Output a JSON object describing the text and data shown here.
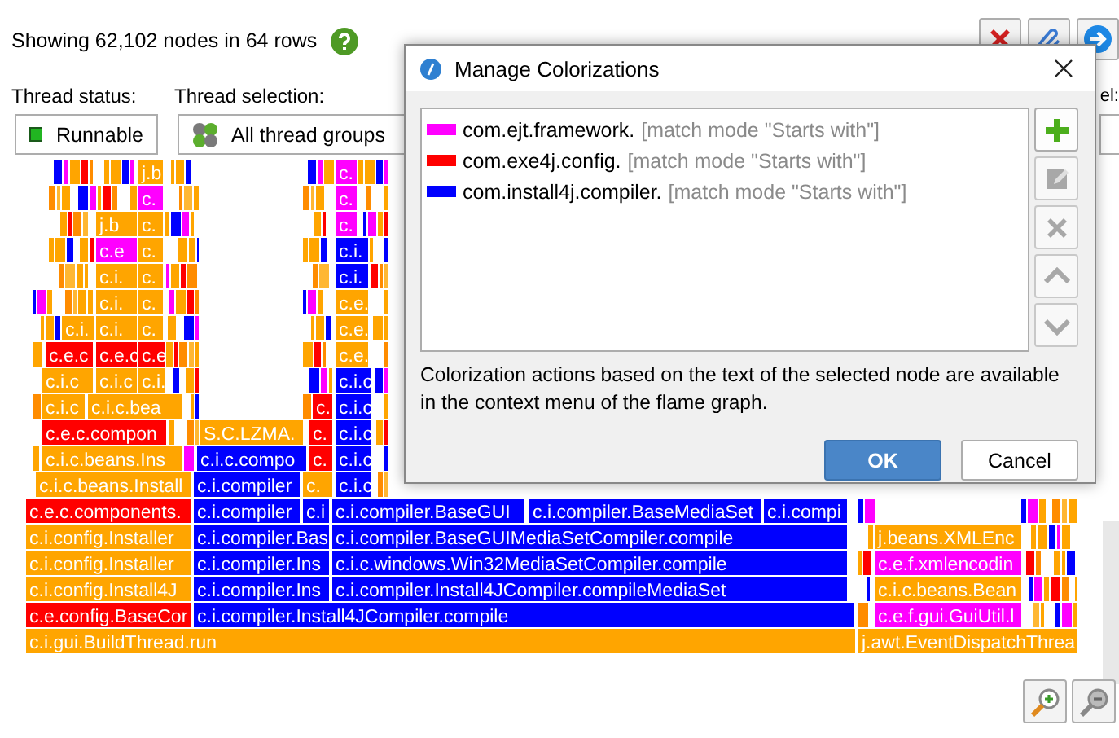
{
  "summary": {
    "text": "Showing 62,102 nodes in 64 rows"
  },
  "filters": [
    {
      "label": "Thread status:",
      "value": "Runnable",
      "kind": "status"
    },
    {
      "label": "Thread selection:",
      "value": "All thread groups",
      "kind": "threads"
    }
  ],
  "level_label": "el:",
  "flame_graph": {
    "rows": [
      [
        {
          "label": "j.b",
          "color": "#ffa500"
        },
        {
          "label": "c.",
          "color": "#ff00ff"
        }
      ],
      [
        {
          "label": "c.",
          "color": "#ff00ff"
        },
        {
          "label": "c.",
          "color": "#ff00ff"
        }
      ],
      [
        {
          "label": "j.b",
          "color": "#ffa500"
        },
        {
          "label": "c.",
          "color": "#ffa500"
        },
        {
          "label": "c.",
          "color": "#ff00ff"
        }
      ],
      [
        {
          "label": "c.e",
          "color": "#ff00ff"
        },
        {
          "label": "c.",
          "color": "#ffa500"
        },
        {
          "label": "c.i.",
          "color": "#0000ff"
        }
      ],
      [
        {
          "label": "c.i.",
          "color": "#ffa500"
        },
        {
          "label": "c.",
          "color": "#ffa500"
        },
        {
          "label": "c.i.",
          "color": "#0000ff"
        }
      ],
      [
        {
          "label": "c.i.",
          "color": "#ffa500"
        },
        {
          "label": "c.",
          "color": "#ffa500"
        },
        {
          "label": "c.e.",
          "color": "#ffa500"
        }
      ],
      [
        {
          "label": "c.i.",
          "color": "#ffa500"
        },
        {
          "label": "c.i.",
          "color": "#ffa500"
        },
        {
          "label": "c.",
          "color": "#ffa500"
        },
        {
          "label": "c.e.",
          "color": "#ffa500"
        }
      ],
      [
        {
          "label": "c.e.c",
          "color": "#ff0000"
        },
        {
          "label": "c.e.c",
          "color": "#ff0000"
        },
        {
          "label": "c.e",
          "color": "#ff0000"
        },
        {
          "label": "c.e.",
          "color": "#ffa500"
        }
      ],
      [
        {
          "label": "c.i.c",
          "color": "#ffa500"
        },
        {
          "label": "c.i.c",
          "color": "#ffa500"
        },
        {
          "label": "c.i.",
          "color": "#ffa500"
        },
        {
          "label": "c.i.c",
          "color": "#0000ff"
        }
      ],
      [
        {
          "label": "c.i.c",
          "color": "#ffa500"
        },
        {
          "label": "c.i.c.bea",
          "color": "#ffa500"
        },
        {
          "label": "c.",
          "color": "#ff0000"
        },
        {
          "label": "c.i.c",
          "color": "#0000ff"
        }
      ],
      [
        {
          "label": "c.e.c.compon",
          "color": "#ff0000"
        },
        {
          "label": "S.C.LZMA.",
          "color": "#ffa500"
        },
        {
          "label": "c.",
          "color": "#ff0000"
        },
        {
          "label": "c.i.c",
          "color": "#0000ff"
        }
      ],
      [
        {
          "label": "c.i.c.beans.Ins",
          "color": "#ffa500"
        },
        {
          "label": "c.i.c.compo",
          "color": "#0000ff"
        },
        {
          "label": "c.",
          "color": "#ff0000"
        },
        {
          "label": "c.i.c",
          "color": "#0000ff"
        }
      ],
      [
        {
          "label": "c.i.c.beans.Install",
          "color": "#ffa500"
        },
        {
          "label": "c.i.compiler",
          "color": "#0000ff"
        },
        {
          "label": "c.",
          "color": "#ffa500"
        },
        {
          "label": "c.i.c",
          "color": "#0000ff"
        }
      ],
      [
        {
          "label": "c.e.c.components.",
          "color": "#ff0000"
        },
        {
          "label": "c.i.compiler",
          "color": "#0000ff"
        },
        {
          "label": "c.i",
          "color": "#0000ff"
        },
        {
          "label": "c.i.compiler.BaseGUI",
          "color": "#0000ff"
        },
        {
          "label": "c.i.compiler.BaseMediaSet",
          "color": "#0000ff"
        },
        {
          "label": "c.i.compi",
          "color": "#0000ff"
        }
      ],
      [
        {
          "label": "c.i.config.Installer",
          "color": "#ffa500"
        },
        {
          "label": "c.i.compiler.Bas",
          "color": "#0000ff"
        },
        {
          "label": "c.i.compiler.BaseGUIMediaSetCompiler.compile",
          "color": "#0000ff"
        },
        {
          "label": "j.beans.XMLEnc",
          "color": "#ffa500"
        }
      ],
      [
        {
          "label": "c.i.config.Installer",
          "color": "#ffa500"
        },
        {
          "label": "c.i.compiler.Ins",
          "color": "#0000ff"
        },
        {
          "label": "c.i.c.windows.Win32MediaSetCompiler.compile",
          "color": "#0000ff"
        },
        {
          "label": "c.e.f.xmlencodin",
          "color": "#ff00ff"
        }
      ],
      [
        {
          "label": "c.i.config.Install4J",
          "color": "#ffa500"
        },
        {
          "label": "c.i.compiler.Ins",
          "color": "#0000ff"
        },
        {
          "label": "c.i.compiler.Install4JCompiler.compileMediaSet",
          "color": "#0000ff"
        },
        {
          "label": "c.i.c.beans.Bean",
          "color": "#ffa500"
        }
      ],
      [
        {
          "label": "c.e.config.BaseCor",
          "color": "#ff0000"
        },
        {
          "label": "c.i.compiler.Install4JCompiler.compile",
          "color": "#0000ff"
        },
        {
          "label": "c.e.f.gui.GuiUtil.l",
          "color": "#ff00ff"
        }
      ],
      [
        {
          "label": "c.i.gui.BuildThread.run",
          "color": "#ffa500"
        },
        {
          "label": "j.awt.EventDispatchThrea",
          "color": "#ffa500"
        }
      ]
    ]
  },
  "dialog": {
    "title": "Manage Colorizations",
    "colorizations": [
      {
        "pattern": "com.ejt.framework.",
        "match_mode": "[match mode \"Starts with\"]",
        "color": "#ff00ff",
        "selected": false
      },
      {
        "pattern": "com.exe4j.config.",
        "match_mode": "[match mode \"Starts with\"]",
        "color": "#ff0000",
        "selected": false
      },
      {
        "pattern": "com.install4j.compiler.",
        "match_mode": "[match mode \"Starts with\"]",
        "color": "#0000ff",
        "selected": false
      }
    ],
    "side_buttons": [
      {
        "kind": "add",
        "disabled": false
      },
      {
        "kind": "edit",
        "disabled": true
      },
      {
        "kind": "delete",
        "disabled": true
      },
      {
        "kind": "up",
        "disabled": true
      },
      {
        "kind": "down",
        "disabled": true
      }
    ],
    "hint": "Colorization actions based on the text of the selected node are available in the context menu of the flame graph.",
    "buttons": [
      {
        "label": "OK",
        "kind": "default"
      },
      {
        "label": "Cancel",
        "kind": "normal"
      }
    ]
  }
}
